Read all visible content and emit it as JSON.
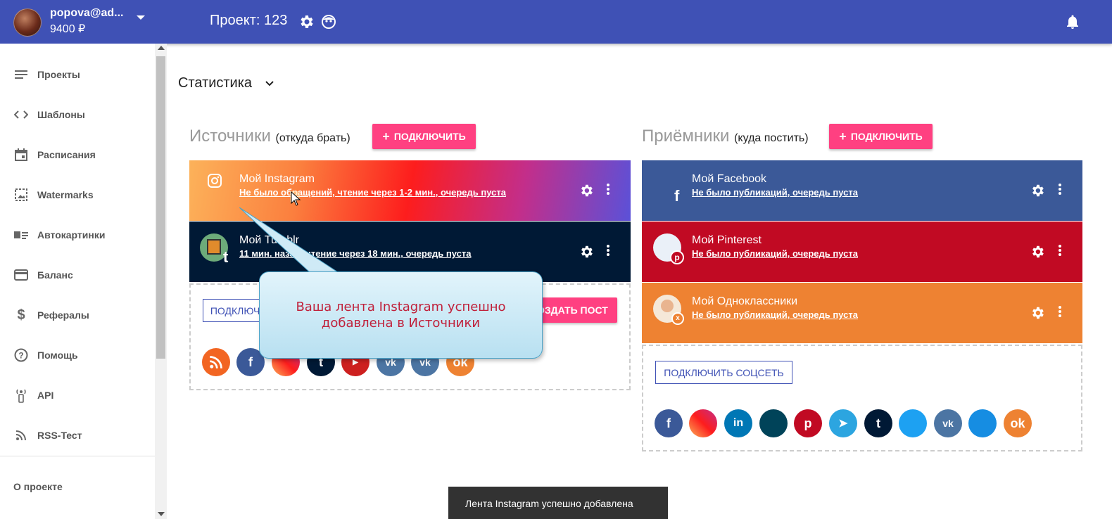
{
  "header": {
    "user_email": "popova@ad...",
    "user_balance": "9400 ₽",
    "project_title": "Проект: 123",
    "bg_color": "#3f51b5"
  },
  "sidebar": {
    "items": [
      {
        "label": "Проекты",
        "icon": "list-icon"
      },
      {
        "label": "Шаблоны",
        "icon": "code-icon"
      },
      {
        "label": "Расписания",
        "icon": "calendar-icon"
      },
      {
        "label": "Watermarks",
        "icon": "image-icon"
      },
      {
        "label": "Автокартинки",
        "icon": "picture-text-icon"
      },
      {
        "label": "Баланс",
        "icon": "card-icon"
      },
      {
        "label": "Рефералы",
        "icon": "dollar-icon"
      },
      {
        "label": "Помощь",
        "icon": "help-icon"
      },
      {
        "label": "API",
        "icon": "antenna-icon"
      },
      {
        "label": "RSS-Тест",
        "icon": "rss-icon"
      }
    ],
    "about": "О проекте"
  },
  "main": {
    "section_title": "Статистика",
    "sources": {
      "title": "Источники",
      "subtitle": "(откуда брать)",
      "connect_label": "ПОДКЛЮЧИТЬ",
      "cards": [
        {
          "name": "Мой Instagram",
          "status": "Не было обращений, чтение через 1-2 мин., очередь пуста"
        },
        {
          "name": "Мой Tumblr",
          "status": "11 мин. назад, чтение через 18 мин., очередь пуста"
        }
      ],
      "connect_source_label": "ПОДКЛЮЧИТЬ",
      "create_post_label": "СОЗДАТЬ ПОСТ",
      "icons": [
        "rss-icon",
        "facebook-icon",
        "instagram-icon",
        "tumblr-icon",
        "youtube-icon",
        "vk-icon",
        "vk-icon",
        "odnoklassniki-icon"
      ]
    },
    "targets": {
      "title": "Приёмники",
      "subtitle": "(куда постить)",
      "connect_label": "ПОДКЛЮЧИТЬ",
      "cards": [
        {
          "name": "Мой Facebook",
          "status": "Не было публикаций, очередь пуста",
          "color": "#3b5998"
        },
        {
          "name": "Мой Pinterest",
          "status": "Не было публикаций, очередь пуста",
          "color": "#c10a23"
        },
        {
          "name": "Мой Одноклассники",
          "status": "Не было публикаций, очередь пуста",
          "color": "#ee8232"
        }
      ],
      "connect_social_label": "ПОДКЛЮЧИТЬ СОЦСЕТЬ",
      "icons": [
        "facebook-icon",
        "instagram-icon",
        "linkedin-icon",
        "livejournal-icon",
        "pinterest-icon",
        "telegram-icon",
        "tumblr-icon",
        "twitter-icon",
        "vk-icon",
        "mailru-icon",
        "odnoklassniki-icon"
      ]
    }
  },
  "tooltip": {
    "line1": "Ваша лента Instagram успешно",
    "line2": "добавлена в Источники"
  },
  "snackbar": {
    "text": "Лента Instagram успешно добавлена"
  }
}
